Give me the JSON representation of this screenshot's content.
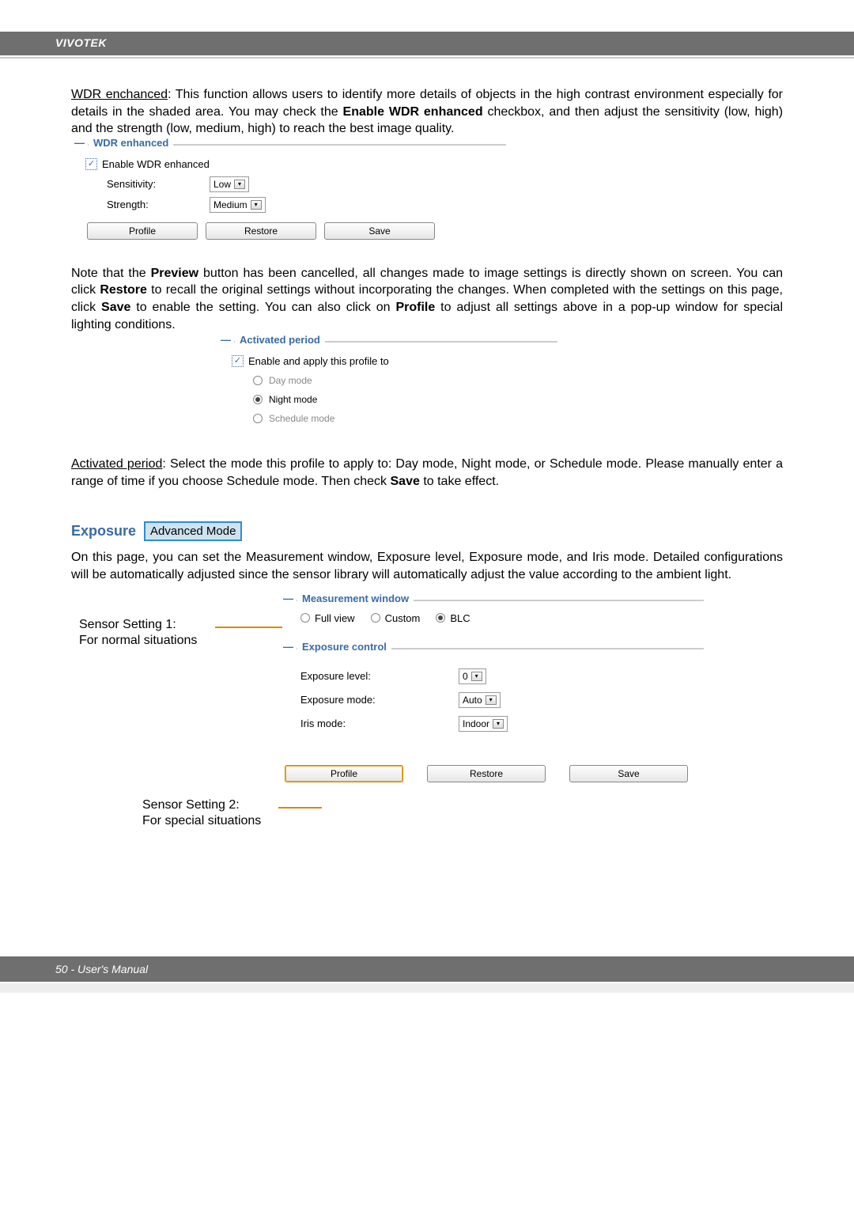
{
  "brand": "VIVOTEK",
  "wdr_intro": {
    "heading": "WDR enchanced",
    "body1": ": This function allows users to identify more details of objects in the high contrast environment especially for details in the shaded area. You may check the ",
    "bold1": "Enable WDR enhanced",
    "body2": " checkbox, and then adjust the sensitivity (low, high) and the strength (low, medium, high) to reach the best image quality."
  },
  "wdr_panel": {
    "title": "WDR enhanced",
    "enable": "Enable WDR enhanced",
    "sensitivity_label": "Sensitivity:",
    "sensitivity_value": "Low",
    "strength_label": "Strength:",
    "strength_value": "Medium",
    "profile": "Profile",
    "restore": "Restore",
    "save": "Save"
  },
  "note_para": {
    "p1": "Note that the ",
    "b1": "Preview",
    "p2": " button has been cancelled, all changes made to image settings is directly shown on screen. You can click ",
    "b2": "Restore",
    "p3": " to recall the original settings without incorporating the changes. When completed with the settings on this page, click ",
    "b3": "Save",
    "p4": " to enable the setting. You can also click on ",
    "b4": "Profile",
    "p5": " to adjust all settings above in a pop-up window for special lighting conditions."
  },
  "activated": {
    "title": "Activated period",
    "enable": "Enable and apply this profile to",
    "day": "Day mode",
    "night": "Night mode",
    "schedule": "Schedule mode"
  },
  "activated_para": {
    "h": "Activated period",
    "p1": ": Select the mode this profile to apply to: Day mode, Night mode, or Schedule mode. Please manually enter a range of time if you choose Schedule mode. Then check ",
    "b1": "Save",
    "p2": " to take effect."
  },
  "exposure": {
    "title": "Exposure",
    "badge": "Advanced Mode",
    "intro": "On this page, you can set the Measurement window, Exposure level, Exposure mode, and Iris mode. Detailed configurations will be automatically adjusted since the sensor library will automatically adjust the value according to the ambient light."
  },
  "sensor1": {
    "line1": "Sensor Setting 1:",
    "line2": "For normal situations"
  },
  "sensor2": {
    "line1": "Sensor Setting 2:",
    "line2": "For special situations"
  },
  "meas": {
    "title": "Measurement window",
    "full": "Full view",
    "custom": "Custom",
    "blc": "BLC"
  },
  "expo_ctrl": {
    "title": "Exposure control",
    "level_label": "Exposure level:",
    "level_value": "0",
    "mode_label": "Exposure mode:",
    "mode_value": "Auto",
    "iris_label": "Iris mode:",
    "iris_value": "Indoor",
    "profile": "Profile",
    "restore": "Restore",
    "save": "Save"
  },
  "footer": "50 - User's Manual"
}
